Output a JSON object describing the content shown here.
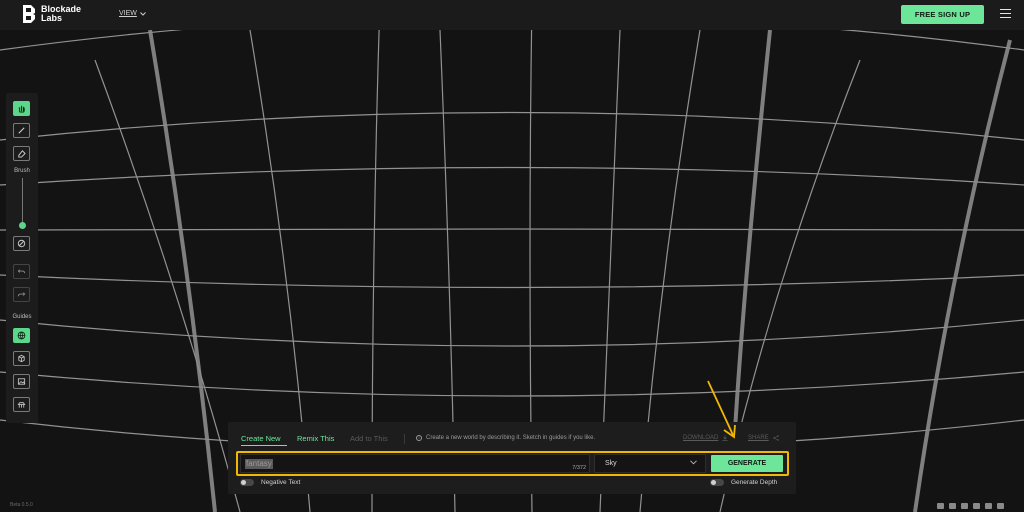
{
  "header": {
    "logo_line1": "Blockade",
    "logo_line2": "Labs",
    "view_label": "VIEW",
    "signup_label": "FREE SIGN UP"
  },
  "toolbar": {
    "brush_label": "Brush",
    "guides_label": "Guides",
    "brush_size_percent": 10,
    "tools": [
      "hand-icon",
      "brush-icon",
      "eraser-icon",
      "clear-icon",
      "undo-icon",
      "redo-icon",
      "globe-icon",
      "cube-icon",
      "image-icon",
      "tabletop-icon"
    ]
  },
  "panel": {
    "tabs": {
      "create": "Create New",
      "remix": "Remix This",
      "add": "Add to This"
    },
    "hint": "Create a new world by describing it. Sketch in guides if you like.",
    "download_label": "DOWNLOAD",
    "share_label": "SHARE",
    "prompt_value": "fantasy",
    "char_counter": "7/372",
    "style_value": "Sky",
    "generate_label": "GENERATE",
    "negative_text_label": "Negative Text",
    "generate_depth_label": "Generate Depth"
  },
  "footer": {
    "version": "Beta 0.5.0",
    "socials": [
      "twitter-icon",
      "instagram-icon",
      "tiktok-icon",
      "discord-icon",
      "youtube-icon",
      "linkedin-icon"
    ]
  },
  "colors": {
    "accent": "#6ee69a",
    "highlight": "#f2b705",
    "background": "#141414"
  }
}
